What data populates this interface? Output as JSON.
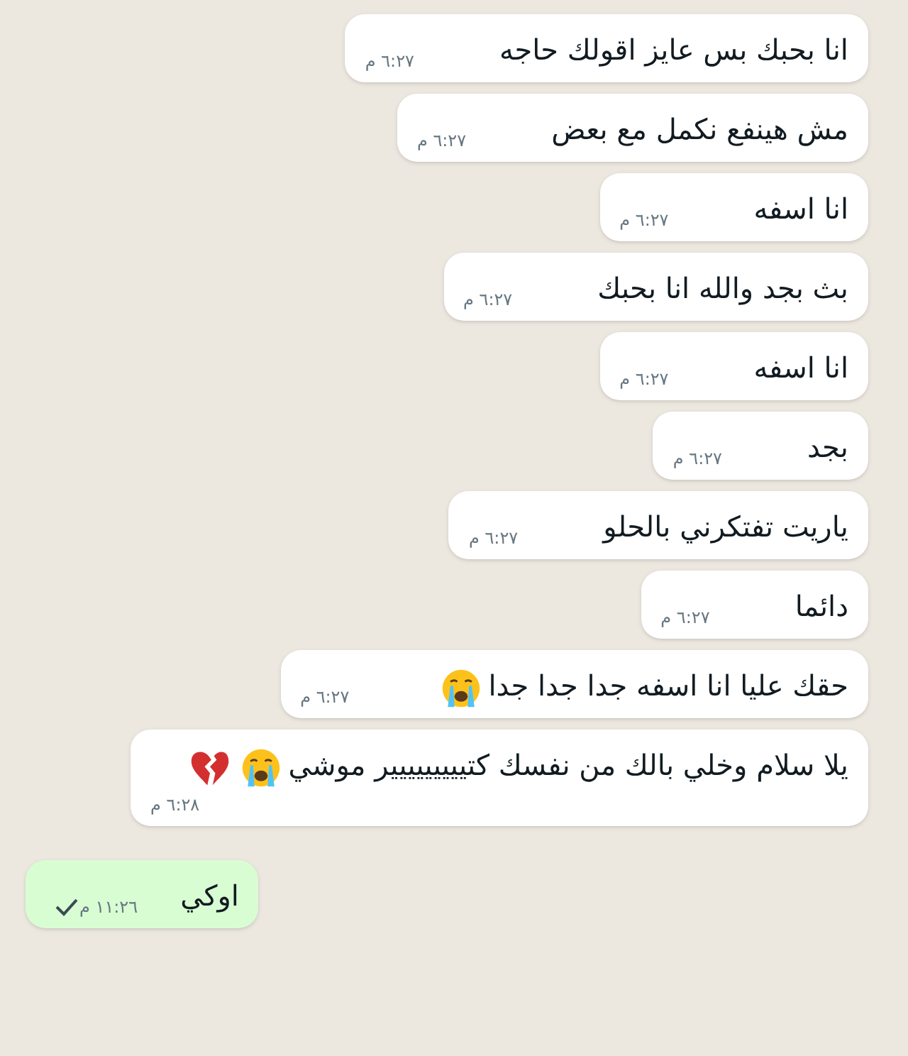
{
  "messages": [
    {
      "kind": "incoming",
      "text": "انا بحبك بس عايز اقولك حاجه",
      "time": "٦:٢٧ م"
    },
    {
      "kind": "incoming",
      "text": "مش هينفع نكمل مع بعض",
      "time": "٦:٢٧ م"
    },
    {
      "kind": "incoming",
      "text": "انا اسفه",
      "time": "٦:٢٧ م"
    },
    {
      "kind": "incoming",
      "text": "بث بجد والله انا بحبك",
      "time": "٦:٢٧ م"
    },
    {
      "kind": "incoming",
      "text": "انا اسفه",
      "time": "٦:٢٧ م"
    },
    {
      "kind": "incoming",
      "text": "بجد",
      "time": "٦:٢٧ م"
    },
    {
      "kind": "incoming",
      "text": "ياريت تفتكرني بالحلو",
      "time": "٦:٢٧ م"
    },
    {
      "kind": "incoming",
      "text": "دائما",
      "time": "٦:٢٧ م"
    },
    {
      "kind": "incoming",
      "text": "حقك عليا انا اسفه جدا جدا جدا",
      "emojis": [
        {
          "kind": "crying"
        }
      ],
      "time": "٦:٢٧ م"
    },
    {
      "kind": "incoming",
      "text": "يلا سلام وخلي بالك من نفسك كتييييييييير موشي",
      "emojis": [
        {
          "kind": "crying"
        },
        {
          "kind": "broken_heart"
        }
      ],
      "time": "٦:٢٨ م"
    },
    {
      "kind": "outgoing",
      "text": "اوكي",
      "time": "١١:٢٦ م",
      "delivered": false
    }
  ]
}
